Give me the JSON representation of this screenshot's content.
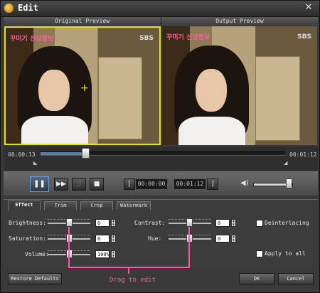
{
  "window": {
    "title": "Edit",
    "close_symbol": "✕"
  },
  "preview": {
    "original_label": "Original Preview",
    "output_label": "Output Preview",
    "video_caption": "꾸미기 신상정보",
    "channel_logo": "SBS"
  },
  "timeline": {
    "current_time": "00:00:13",
    "total_time": "00:01:12",
    "progress_fraction": 0.18
  },
  "player": {
    "play_pause_symbol": "❚❚",
    "fast_forward_symbol": "▶▶",
    "frame_symbol": "▯",
    "stop_symbol": "■",
    "start_bracket": "[",
    "end_bracket": "]",
    "start_time": "00:00:00",
    "end_time": "00:01:12",
    "volume_symbol": "◀)",
    "volume_fraction": 0.92
  },
  "tabs": [
    {
      "label": "Effect",
      "active": true
    },
    {
      "label": "Trim",
      "active": false
    },
    {
      "label": "Crop",
      "active": false
    },
    {
      "label": "Watermark",
      "active": false
    }
  ],
  "effect": {
    "brightness": {
      "label": "Brightness:",
      "value": "0"
    },
    "saturation": {
      "label": "Saturation:",
      "value": "0"
    },
    "volume": {
      "label": "Volume:",
      "value": "100%"
    },
    "contrast": {
      "label": "Contrast:",
      "value": "0"
    },
    "hue": {
      "label": "Hue:",
      "value": "0"
    },
    "deinterlacing_label": "Deinterlacing",
    "apply_all_label": "Apply to all"
  },
  "annotation": {
    "text": "Drag to edit"
  },
  "buttons": {
    "restore_defaults": "Restore Defaults",
    "ok": "OK",
    "cancel": "Cancel"
  }
}
